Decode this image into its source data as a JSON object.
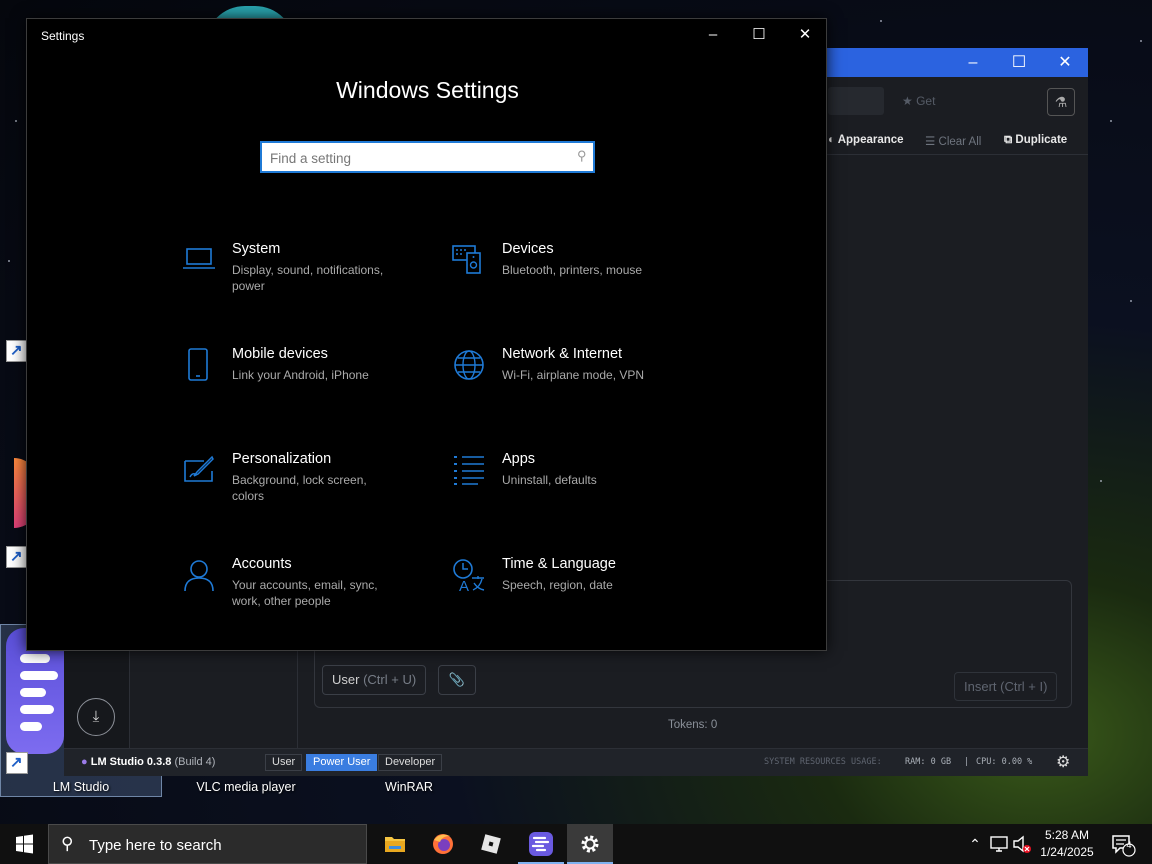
{
  "desktop": {
    "icons": [
      {
        "label": "LM Studio"
      },
      {
        "label": "VLC media player"
      },
      {
        "label": "WinRAR"
      }
    ]
  },
  "lm_studio": {
    "search_placeholder": "Get",
    "toolbar": {
      "appearance": "Appearance",
      "clear_all": "Clear All",
      "duplicate": "Duplicate"
    },
    "composer": {
      "role_button": "User",
      "role_shortcut": "(Ctrl + U)",
      "insert_button": "Insert (Ctrl + I)"
    },
    "tokens": "Tokens: 0",
    "status": {
      "brand": "LM Studio 0.3.8",
      "build": "(Build 4)",
      "modes": [
        "User",
        "Power User",
        "Developer"
      ],
      "active_mode": "Power User",
      "resources_label": "SYSTEM RESOURCES USAGE:",
      "ram": "RAM: 0 GB",
      "separator": "|",
      "cpu": "CPU: 0.00 %"
    }
  },
  "settings": {
    "window_title": "Settings",
    "heading": "Windows Settings",
    "search_placeholder": "Find a setting",
    "accent": "#1f7ad6",
    "tiles": [
      {
        "name": "System",
        "desc": "Display, sound, notifications, power",
        "icon": "laptop-icon"
      },
      {
        "name": "Devices",
        "desc": "Bluetooth, printers, mouse",
        "icon": "devices-icon"
      },
      {
        "name": "Mobile devices",
        "desc": "Link your Android, iPhone",
        "icon": "phone-icon"
      },
      {
        "name": "Network & Internet",
        "desc": "Wi-Fi, airplane mode, VPN",
        "icon": "globe-icon"
      },
      {
        "name": "Personalization",
        "desc": "Background, lock screen, colors",
        "icon": "brush-icon"
      },
      {
        "name": "Apps",
        "desc": "Uninstall, defaults",
        "icon": "apps-list-icon"
      },
      {
        "name": "Accounts",
        "desc": "Your accounts, email, sync, work, other people",
        "icon": "person-icon"
      },
      {
        "name": "Time & Language",
        "desc": "Speech, region, date",
        "icon": "time-language-icon"
      }
    ]
  },
  "taskbar": {
    "search_placeholder": "Type here to search",
    "time": "5:28 AM",
    "date": "1/24/2025",
    "notification_count": "4"
  }
}
